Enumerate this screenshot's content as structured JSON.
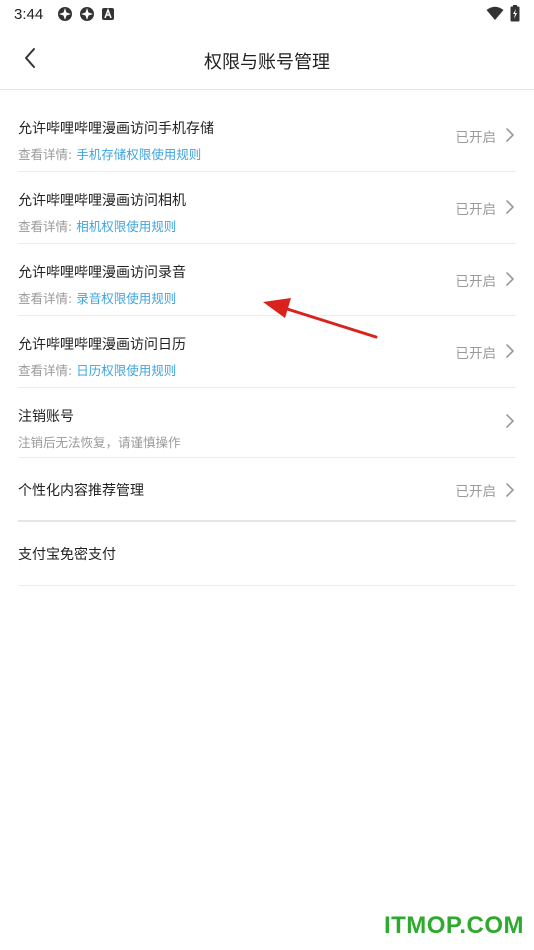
{
  "status_bar": {
    "time": "3:44"
  },
  "header": {
    "title": "权限与账号管理"
  },
  "rows": [
    {
      "title": "允许哔哩哔哩漫画访问手机存储",
      "sub_prefix": "查看详情:",
      "sub_link": "手机存储权限使用规则",
      "status": "已开启"
    },
    {
      "title": "允许哔哩哔哩漫画访问相机",
      "sub_prefix": "查看详情:",
      "sub_link": "相机权限使用规则",
      "status": "已开启"
    },
    {
      "title": "允许哔哩哔哩漫画访问录音",
      "sub_prefix": "查看详情:",
      "sub_link": "录音权限使用规则",
      "status": "已开启"
    },
    {
      "title": "允许哔哩哔哩漫画访问日历",
      "sub_prefix": "查看详情:",
      "sub_link": "日历权限使用规则",
      "status": "已开启"
    },
    {
      "title": "注销账号",
      "sub_prefix": "注销后无法恢复，请谨慎操作",
      "sub_link": "",
      "status": ""
    },
    {
      "title": "个性化内容推荐管理",
      "status": "已开启"
    },
    {
      "title": "支付宝免密支付"
    }
  ],
  "colors": {
    "link": "#3fa4e0",
    "muted": "#9a9a9a",
    "annotation_arrow": "#d9221c",
    "watermark": "#2eaa2e"
  },
  "watermark": "ITMOP.COM"
}
